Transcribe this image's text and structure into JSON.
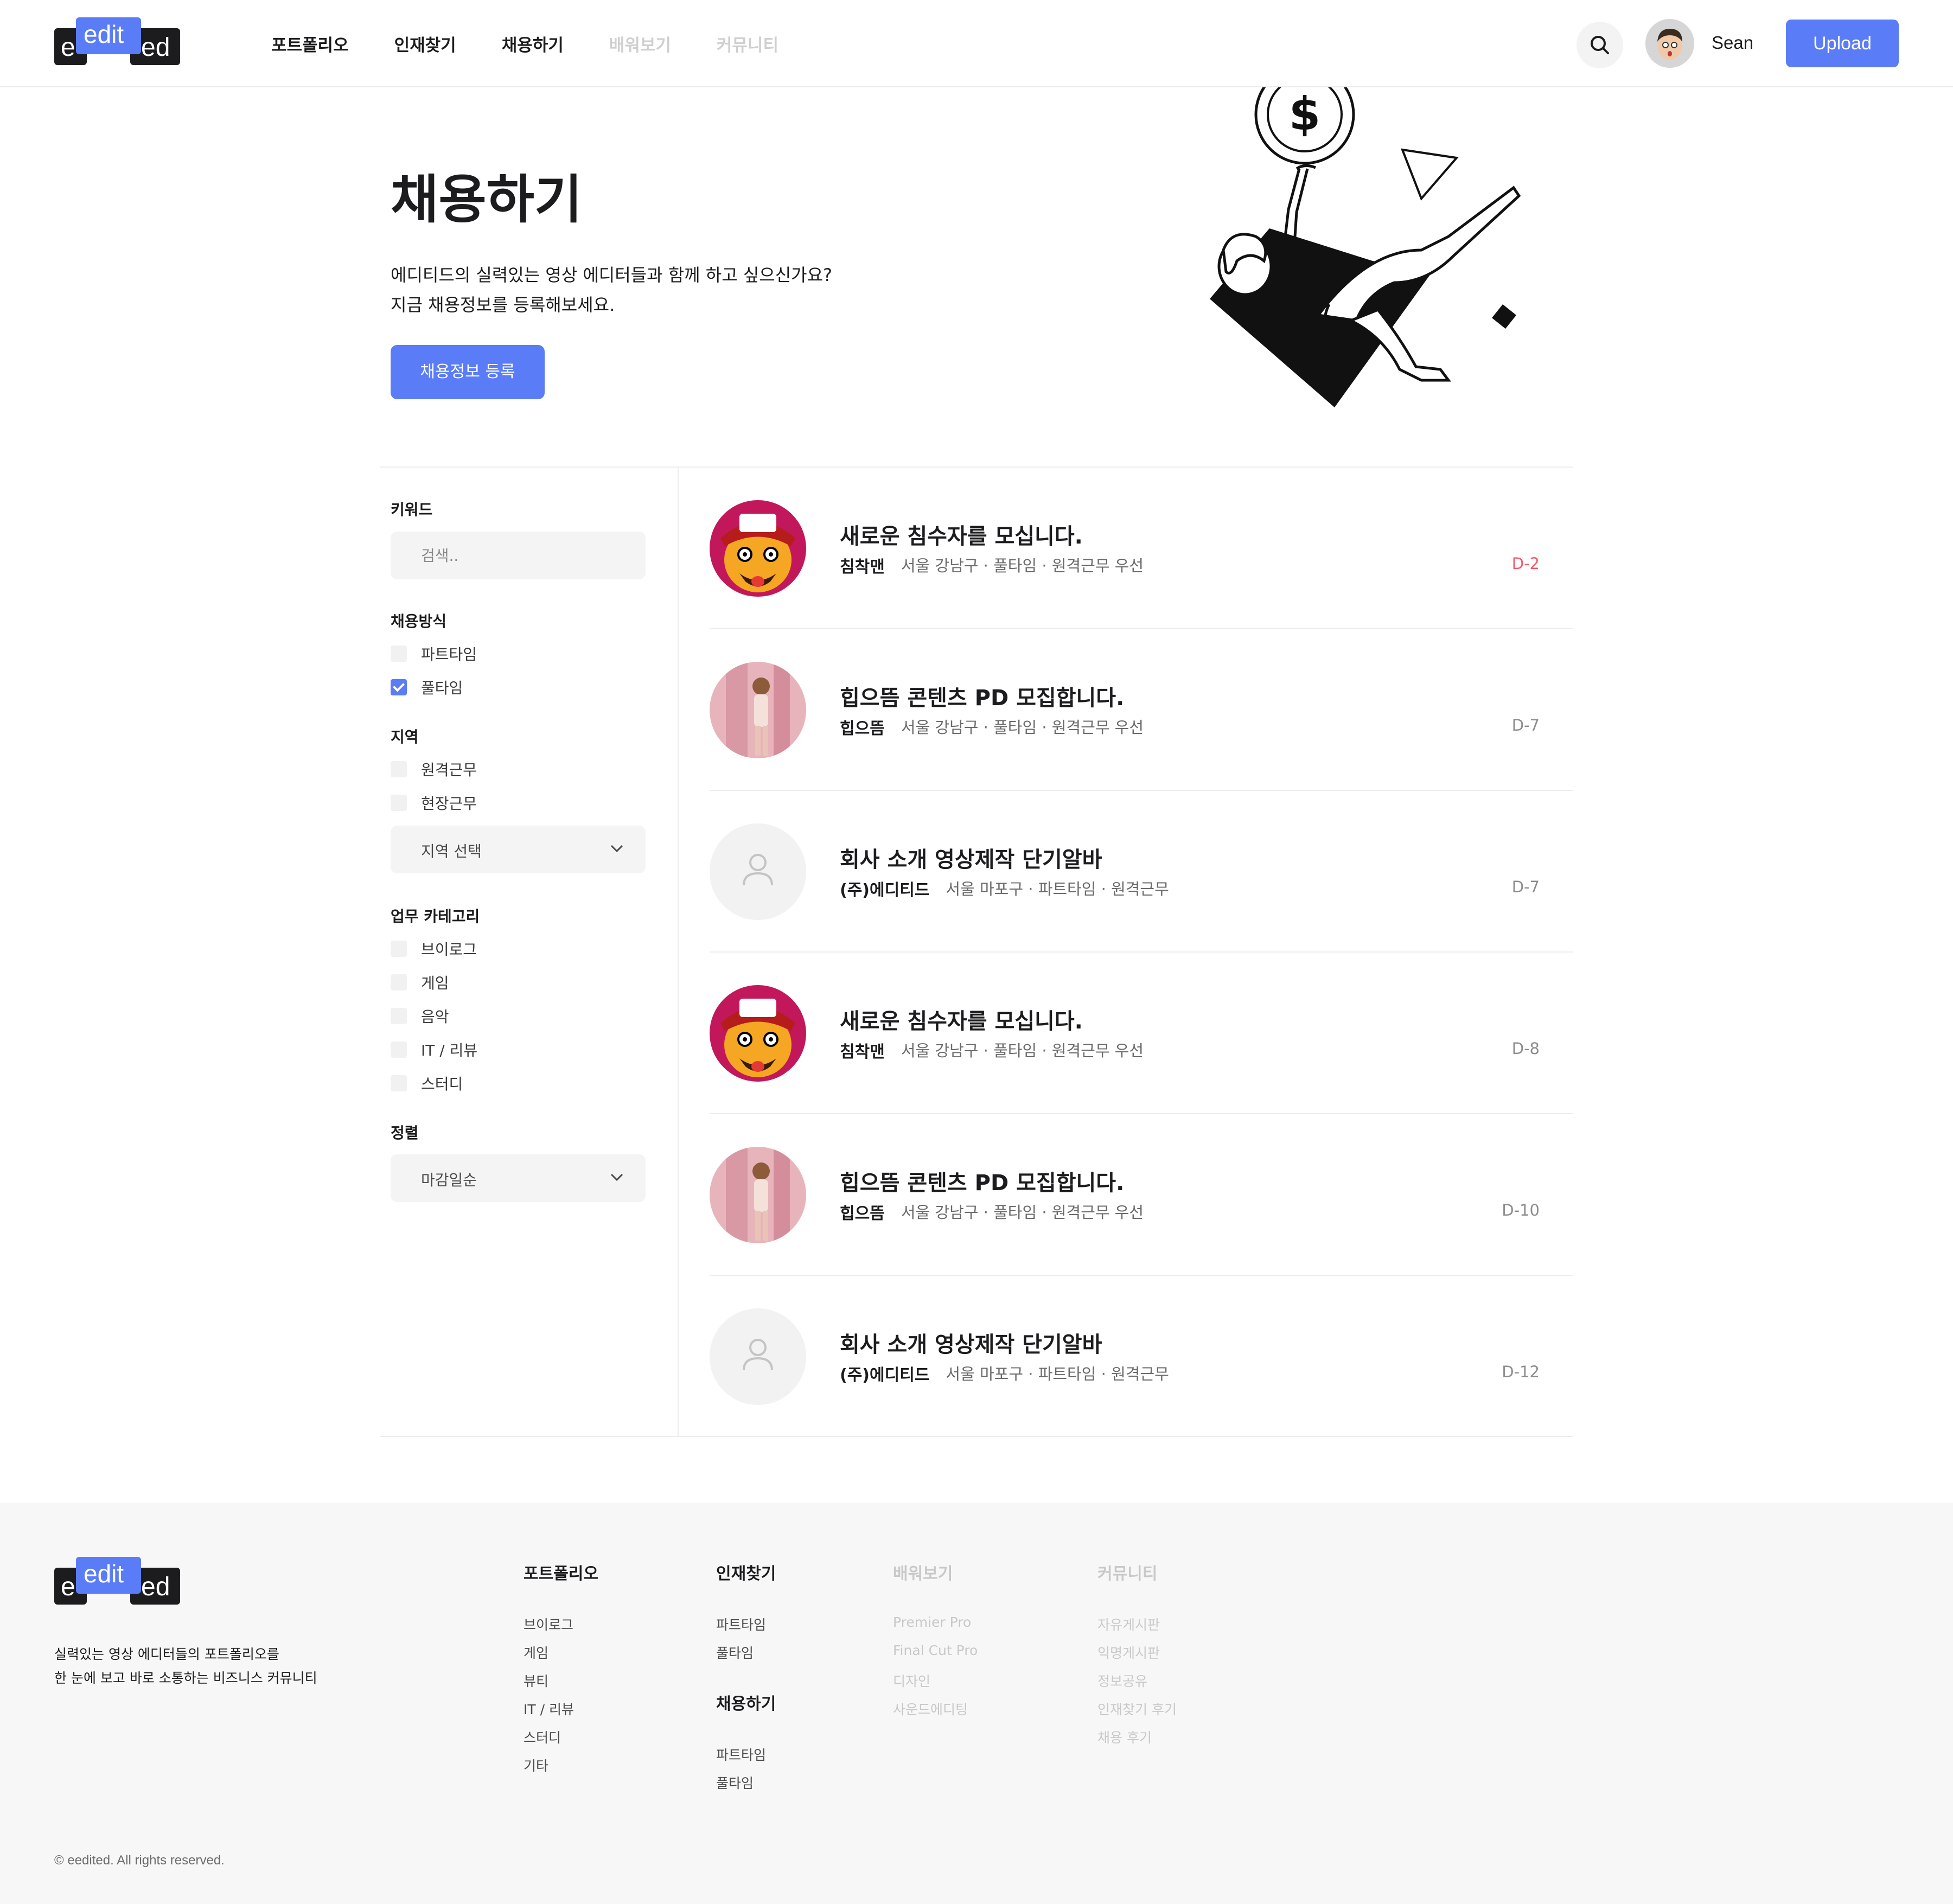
{
  "brand": {
    "logo_e": "e",
    "logo_edit": "edit",
    "logo_ed": "ed"
  },
  "nav": {
    "items": [
      {
        "label": "포트폴리오",
        "active": true
      },
      {
        "label": "인재찾기",
        "active": true
      },
      {
        "label": "채용하기",
        "active": true
      },
      {
        "label": "배워보기",
        "active": false
      },
      {
        "label": "커뮤니티",
        "active": false
      }
    ]
  },
  "header": {
    "search_icon": "search-icon",
    "username": "Sean",
    "upload_label": "Upload"
  },
  "hero": {
    "title": "채용하기",
    "desc_line1": "에디티드의 실력있는 영상 에디터들과 함께 하고 싶으신가요?",
    "desc_line2": "지금 채용정보를 등록해보세요.",
    "button": "채용정보 등록",
    "illustration_dollar": "$"
  },
  "filters": {
    "keyword_label": "키워드",
    "keyword_placeholder": "검색..",
    "hiring_label": "채용방식",
    "hiring_options": [
      {
        "label": "파트타임",
        "checked": false
      },
      {
        "label": "풀타임",
        "checked": true
      }
    ],
    "region_label": "지역",
    "region_options": [
      {
        "label": "원격근무",
        "checked": false
      },
      {
        "label": "현장근무",
        "checked": false
      }
    ],
    "region_select": "지역 선택",
    "category_label": "업무 카테고리",
    "category_options": [
      {
        "label": "브이로그",
        "checked": false
      },
      {
        "label": "게임",
        "checked": false
      },
      {
        "label": "음악",
        "checked": false
      },
      {
        "label": "IT / 리뷰",
        "checked": false
      },
      {
        "label": "스터디",
        "checked": false
      }
    ],
    "sort_label": "정렬",
    "sort_select": "마감일순"
  },
  "jobs": [
    {
      "title": "새로운 침수자를 모십니다.",
      "company": "침착맨",
      "info": "서울 강남구 · 풀타임 · 원격근무 우선",
      "dday": "D-2",
      "logo": "cartoon-face",
      "urgent": true
    },
    {
      "title": "힙으뜸 콘텐츠 PD 모집합니다.",
      "company": "힙으뜸",
      "info": "서울 강남구 · 풀타임 · 원격근무 우선",
      "dday": "D-7",
      "logo": "photo-pink",
      "urgent": false
    },
    {
      "title": "회사 소개 영상제작 단기알바",
      "company": "(주)에디티드",
      "info": "서울 마포구 · 파트타임 · 원격근무",
      "dday": "D-7",
      "logo": "user-placeholder",
      "urgent": false
    },
    {
      "title": "새로운 침수자를 모십니다.",
      "company": "침착맨",
      "info": "서울 강남구 · 풀타임 · 원격근무 우선",
      "dday": "D-8",
      "logo": "cartoon-face",
      "urgent": false
    },
    {
      "title": "힙으뜸 콘텐츠 PD 모집합니다.",
      "company": "힙으뜸",
      "info": "서울 강남구 · 풀타임 · 원격근무 우선",
      "dday": "D-10",
      "logo": "photo-pink",
      "urgent": false
    },
    {
      "title": "회사 소개 영상제작 단기알바",
      "company": "(주)에디티드",
      "info": "서울 마포구 · 파트타임 · 원격근무",
      "dday": "D-12",
      "logo": "user-placeholder",
      "urgent": false
    }
  ],
  "footer": {
    "tagline_line1": "실력있는 영상 에디터들의 포트폴리오를",
    "tagline_line2": "한 눈에 보고 바로 소통하는 비즈니스 커뮤니티",
    "col_portfolio": {
      "title": "포트폴리오",
      "links": [
        "브이로그",
        "게임",
        "뷰티",
        "IT / 리뷰",
        "스터디",
        "기타"
      ]
    },
    "col_talent": {
      "title": "인재찾기",
      "links": [
        "파트타임",
        "풀타임"
      ]
    },
    "col_hiring": {
      "title": "채용하기",
      "links": [
        "파트타임",
        "풀타임"
      ]
    },
    "col_learn": {
      "title": "배워보기",
      "links": [
        "Premier Pro",
        "Final Cut Pro",
        "디자인",
        "사운드에디팅"
      ]
    },
    "col_community": {
      "title": "커뮤니티",
      "links": [
        "자유게시판",
        "익명게시판",
        "정보공유",
        "인재찾기 후기",
        "채용 후기"
      ]
    },
    "copyright": "© eedited. All rights reserved."
  },
  "colors": {
    "accent": "#5b7cf7",
    "urgent": "#f15a6b",
    "text": "#1c1c1e",
    "muted": "#8c8c8c",
    "footer_bg": "#f7f7f7"
  }
}
